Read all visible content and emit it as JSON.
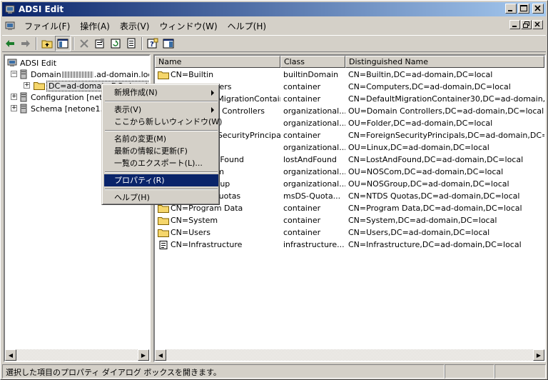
{
  "window": {
    "title": "ADSI Edit"
  },
  "menubar": {
    "items": [
      "ファイル(F)",
      "操作(A)",
      "表示(V)",
      "ウィンドウ(W)",
      "ヘルプ(H)"
    ]
  },
  "tree": {
    "root": "ADSI Edit",
    "domain_prefix": "Domain",
    "domain_suffix": ".ad-domain.loc",
    "dc_node": "DC=ad-domain,DC=local",
    "configuration": "Configuration [net",
    "schema": "Schema [netone1.a"
  },
  "list": {
    "columns": [
      "Name",
      "Class",
      "Distinguished Name"
    ],
    "rows": [
      {
        "name": "CN=Builtin",
        "class": "builtinDomain",
        "dn": "CN=Builtin,DC=ad-domain,DC=local",
        "icon": "folder-icon"
      },
      {
        "name": "CN=Computers",
        "class": "container",
        "dn": "CN=Computers,DC=ad-domain,DC=local",
        "icon": "folder-icon"
      },
      {
        "name": "CN=DefaultMigrationContain...",
        "class": "container",
        "dn": "CN=DefaultMigrationContainer30,DC=ad-domain,DC=l",
        "icon": "folder-icon"
      },
      {
        "name": "OU=Domain Controllers",
        "class": "organizational...",
        "dn": "OU=Domain Controllers,DC=ad-domain,DC=local",
        "icon": "folder-icon"
      },
      {
        "name": "OU=Folder",
        "class": "organizational...",
        "dn": "OU=Folder,DC=ad-domain,DC=local",
        "icon": "folder-icon"
      },
      {
        "name": "CN=ForeignSecurityPrincipals",
        "class": "container",
        "dn": "CN=ForeignSecurityPrincipals,DC=ad-domain,DC=local",
        "icon": "folder-icon"
      },
      {
        "name": "OU=Linux",
        "class": "organizational...",
        "dn": "OU=Linux,DC=ad-domain,DC=local",
        "icon": "folder-icon"
      },
      {
        "name": "CN=LostAndFound",
        "class": "lostAndFound",
        "dn": "CN=LostAndFound,DC=ad-domain,DC=local",
        "icon": "folder-icon"
      },
      {
        "name": "OU=NOSCom",
        "class": "organizational...",
        "dn": "OU=NOSCom,DC=ad-domain,DC=local",
        "icon": "folder-icon"
      },
      {
        "name": "OU=NOSGroup",
        "class": "organizational...",
        "dn": "OU=NOSGroup,DC=ad-domain,DC=local",
        "icon": "folder-icon"
      },
      {
        "name": "CN=NTDS Quotas",
        "class": "msDS-Quota...",
        "dn": "CN=NTDS Quotas,DC=ad-domain,DC=local",
        "icon": "folder-icon"
      },
      {
        "name": "CN=Program Data",
        "class": "container",
        "dn": "CN=Program Data,DC=ad-domain,DC=local",
        "icon": "folder-icon"
      },
      {
        "name": "CN=System",
        "class": "container",
        "dn": "CN=System,DC=ad-domain,DC=local",
        "icon": "folder-icon"
      },
      {
        "name": "CN=Users",
        "class": "container",
        "dn": "CN=Users,DC=ad-domain,DC=local",
        "icon": "folder-icon"
      },
      {
        "name": "CN=Infrastructure",
        "class": "infrastructure...",
        "dn": "CN=Infrastructure,DC=ad-domain,DC=local",
        "icon": "document-icon"
      }
    ]
  },
  "context_menu": {
    "new": "新規作成(N)",
    "view": "表示(V)",
    "new_window": "ここから新しいウィンドウ(W)",
    "rename": "名前の変更(M)",
    "refresh": "最新の情報に更新(F)",
    "export": "一覧のエクスポート(L)...",
    "properties": "プロパティ(R)",
    "help": "ヘルプ(H)"
  },
  "statusbar": {
    "text": "選択した項目のプロパティ ダイアログ ボックスを開きます。"
  },
  "colors": {
    "titlebar_start": "#0a246a",
    "titlebar_end": "#a6caf0",
    "selection": "#0a246a",
    "folder": "#f5d66b"
  }
}
